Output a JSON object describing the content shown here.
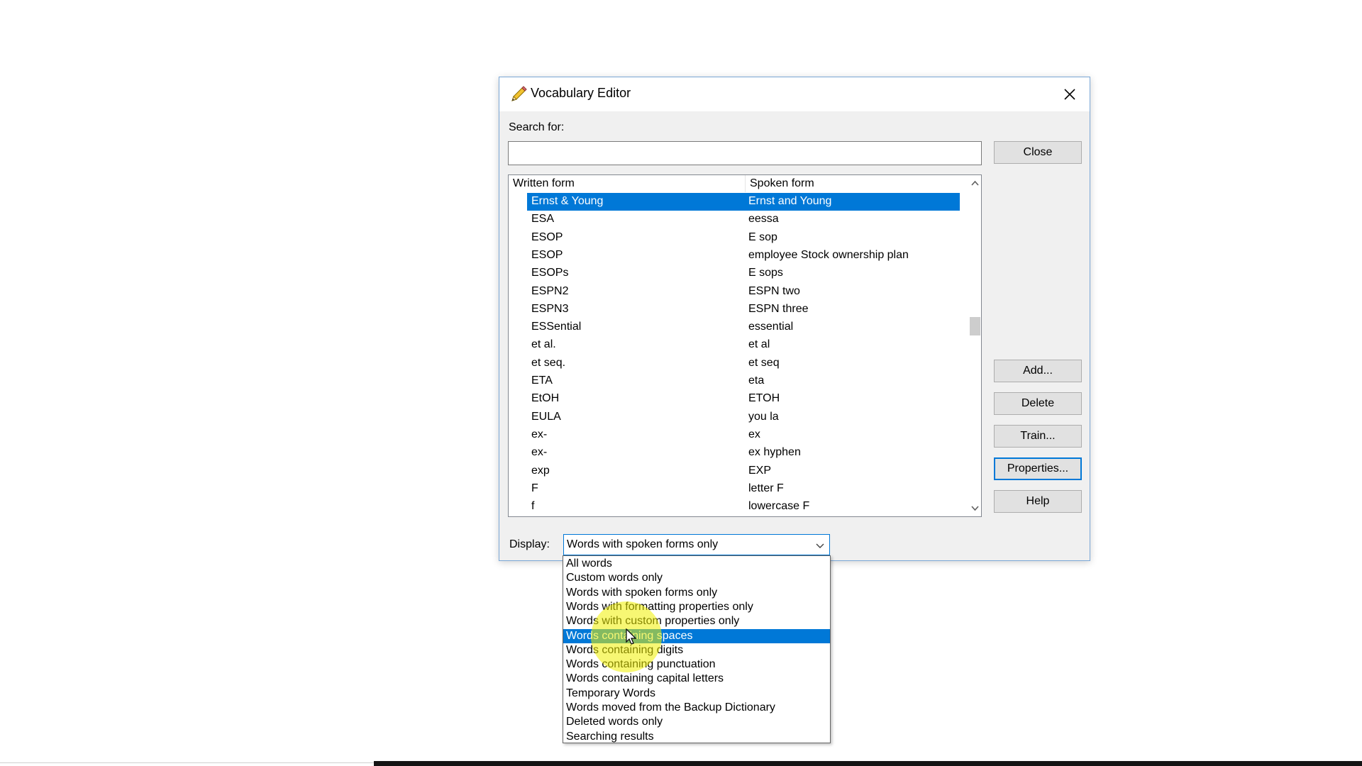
{
  "window": {
    "title": "Vocabulary Editor",
    "icon": "pencil-icon"
  },
  "search": {
    "label": "Search for:",
    "value": "",
    "placeholder": ""
  },
  "buttons": {
    "close": "Close",
    "add": "Add...",
    "delete": "Delete",
    "train": "Train...",
    "properties": "Properties...",
    "help": "Help"
  },
  "table": {
    "columns": [
      "Written form",
      "Spoken form"
    ],
    "rows": [
      {
        "written": "Ernst & Young",
        "spoken": "Ernst and Young",
        "selected": true
      },
      {
        "written": "ESA",
        "spoken": "eessa"
      },
      {
        "written": "ESOP",
        "spoken": "E sop"
      },
      {
        "written": "ESOP",
        "spoken": "employee Stock ownership plan"
      },
      {
        "written": "ESOPs",
        "spoken": "E sops"
      },
      {
        "written": "ESPN2",
        "spoken": "ESPN two"
      },
      {
        "written": "ESPN3",
        "spoken": "ESPN three"
      },
      {
        "written": "ESSential",
        "spoken": "essential"
      },
      {
        "written": "et al.",
        "spoken": "et al"
      },
      {
        "written": "et seq.",
        "spoken": "et seq"
      },
      {
        "written": "ETA",
        "spoken": "eta"
      },
      {
        "written": "EtOH",
        "spoken": "ETOH"
      },
      {
        "written": "EULA",
        "spoken": "you la"
      },
      {
        "written": "ex-",
        "spoken": "ex"
      },
      {
        "written": "ex-",
        "spoken": "ex hyphen"
      },
      {
        "written": "exp",
        "spoken": "EXP"
      },
      {
        "written": "F",
        "spoken": "letter F"
      },
      {
        "written": "f",
        "spoken": "lowercase F"
      }
    ]
  },
  "display": {
    "label": "Display:",
    "value": "Words with spoken forms only",
    "options": [
      "All words",
      "Custom words only",
      "Words with spoken forms only",
      "Words with formatting properties only",
      "Words with custom properties only",
      "Words containing spaces",
      "Words containing digits",
      "Words containing punctuation",
      "Words containing capital letters",
      "Temporary Words",
      "Words moved from the Backup Dictionary",
      "Deleted words only",
      "Searching results"
    ],
    "highlighted_option": 5
  },
  "colors": {
    "selection": "#0078d7",
    "dialog_bg": "#f0f0f0",
    "cursor_highlight": "#f0f000"
  }
}
